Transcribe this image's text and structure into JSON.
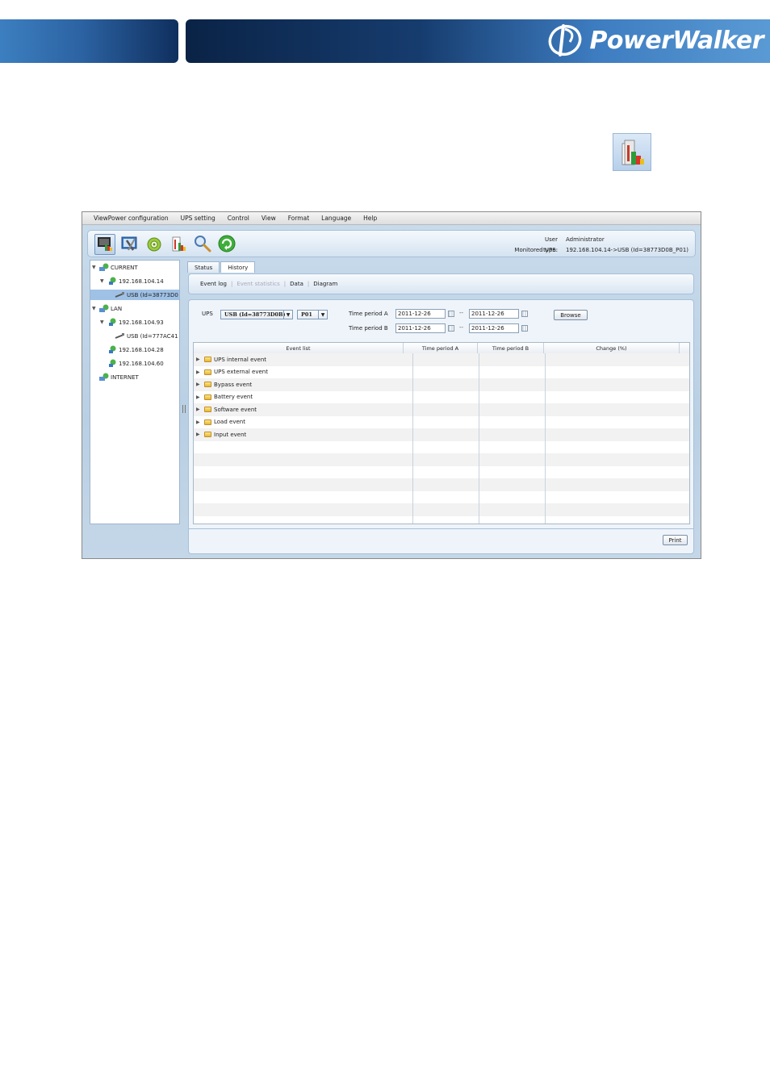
{
  "banner": {
    "brand": "PowerWalker"
  },
  "highlight_icon": {
    "name": "history-chart-icon"
  },
  "app": {
    "menu": [
      "ViewPower configuration",
      "UPS setting",
      "Control",
      "View",
      "Format",
      "Language",
      "Help"
    ],
    "toolbar": {
      "buttons": [
        "monitor-icon",
        "tools-icon",
        "gear-icon",
        "history-icon",
        "search-icon",
        "refresh-icon"
      ],
      "user_type_label": "User type:",
      "user_type_value": "Administrator",
      "monitored_label": "Monitored UPS:",
      "monitored_value": "192.168.104.14->USB (Id=38773D0B_P01)"
    },
    "tree": {
      "current": "CURRENT",
      "current_ip": "192.168.104.14",
      "current_usb": "USB (Id=38773D0",
      "lan": "LAN",
      "lan_ip1": "192.168.104.93",
      "lan_usb": "USB (Id=777AC41",
      "lan_ip2": "192.168.104.28",
      "lan_ip3": "192.168.104.60",
      "internet": "INTERNET"
    },
    "tabs": [
      "Status",
      "History"
    ],
    "subtabs": {
      "event_log": "Event log",
      "event_statistics": "Event statistics",
      "data": "Data",
      "diagram": "Diagram"
    },
    "filters": {
      "ups_label": "UPS",
      "ups_value": "USB (Id=38773D0B)",
      "port_value": "P01",
      "period_a_label": "Time period A",
      "period_b_label": "Time period B",
      "a_from": "2011-12-26",
      "a_to": "2011-12-26",
      "b_from": "2011-12-26",
      "b_to": "2011-12-26",
      "range_sep": "--",
      "browse_label": "Browse"
    },
    "table": {
      "columns": [
        "Event list",
        "Time period A",
        "Time period B",
        "Change (%)"
      ],
      "rows": [
        "UPS internal event",
        "UPS external event",
        "Bypass event",
        "Battery event",
        "Software event",
        "Load event",
        "Input event"
      ]
    },
    "print_label": "Print",
    "colors": {
      "selection": "#9fc1e6",
      "window_bg": "#c9dcec",
      "banner_dark": "#0a2346"
    }
  }
}
